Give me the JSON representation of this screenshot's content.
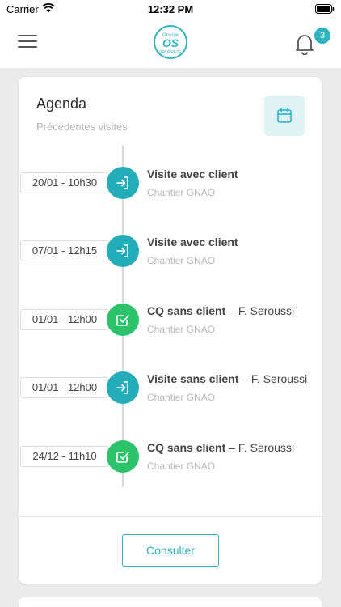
{
  "status_bar": {
    "carrier": "Carrier",
    "time": "12:32 PM"
  },
  "header": {
    "logo": {
      "top": "Groupe",
      "main": "OS",
      "sub": "PROPRETÉ"
    },
    "notification_count": "3"
  },
  "agenda": {
    "title": "Agenda",
    "subtitle": "Précédentes visites",
    "items": [
      {
        "date": "20/01 - 10h30",
        "title": "Visite avec client",
        "person": "",
        "site": "Chantier GNAO",
        "icon": "sign-in-icon",
        "color": "teal"
      },
      {
        "date": "07/01 - 12h15",
        "title": "Visite avec client",
        "person": "",
        "site": "Chantier GNAO",
        "icon": "sign-in-icon",
        "color": "teal"
      },
      {
        "date": "01/01 - 12h00",
        "title": "CQ sans client",
        "person": " – F. Seroussi",
        "site": "Chantier GNAO",
        "icon": "checkbox-icon",
        "color": "green"
      },
      {
        "date": "01/01 - 12h00",
        "title": "Visite sans client",
        "person": " – F. Seroussi",
        "site": "Chantier GNAO",
        "icon": "sign-in-icon",
        "color": "teal"
      },
      {
        "date": "24/12 - 11h10",
        "title": "CQ sans client",
        "person": " – F. Seroussi",
        "site": "Chantier GNAO",
        "icon": "checkbox-icon",
        "color": "green"
      }
    ],
    "consult_label": "Consulter"
  },
  "colors": {
    "accent": "#2fb3be",
    "teal": "#23adb8",
    "green": "#2bc26a"
  }
}
